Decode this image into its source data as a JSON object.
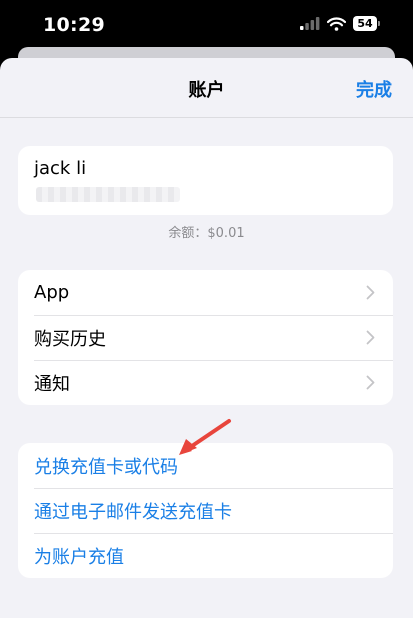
{
  "status_bar": {
    "time": "10:29",
    "battery": "54"
  },
  "nav": {
    "title": "账户",
    "done_label": "完成"
  },
  "account": {
    "name": "jack li",
    "balance_text": "余额：$0.01"
  },
  "menu_group_1": [
    {
      "label": "App"
    },
    {
      "label": "购买历史"
    },
    {
      "label": "通知"
    }
  ],
  "menu_group_2": [
    {
      "label": "兑换充值卡或代码"
    },
    {
      "label": "通过电子邮件发送充值卡"
    },
    {
      "label": "为账户充值"
    }
  ],
  "colors": {
    "accent": "#1a7fe6",
    "annotation_arrow": "#e8453c"
  }
}
